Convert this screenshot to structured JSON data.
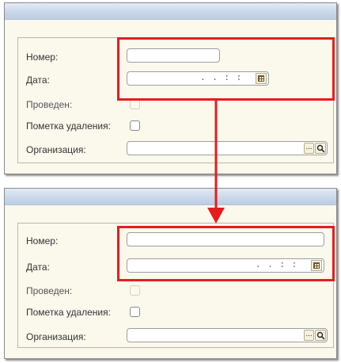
{
  "form_before": {
    "fields": {
      "number_label": "Номер:",
      "date_label": "Дата:",
      "date_mask": ". .   : :",
      "posted_label": "Проведен:",
      "deletion_mark_label": "Пометка удаления:",
      "organization_label": "Организация:",
      "select_button": "..."
    }
  },
  "form_after": {
    "fields": {
      "number_label": "Номер:",
      "date_label": "Дата:",
      "date_mask": ". .   : :",
      "posted_label": "Проведен:",
      "deletion_mark_label": "Пометка удаления:",
      "organization_label": "Организация:",
      "select_button": "..."
    }
  },
  "annotation": {
    "highlight_color": "#e51d1d",
    "arrow_icon": "arrow-down-icon"
  },
  "colors": {
    "form_background": "#fbf8ec",
    "titlebar": "#cad8ea",
    "input_border": "#9e9e9e"
  }
}
